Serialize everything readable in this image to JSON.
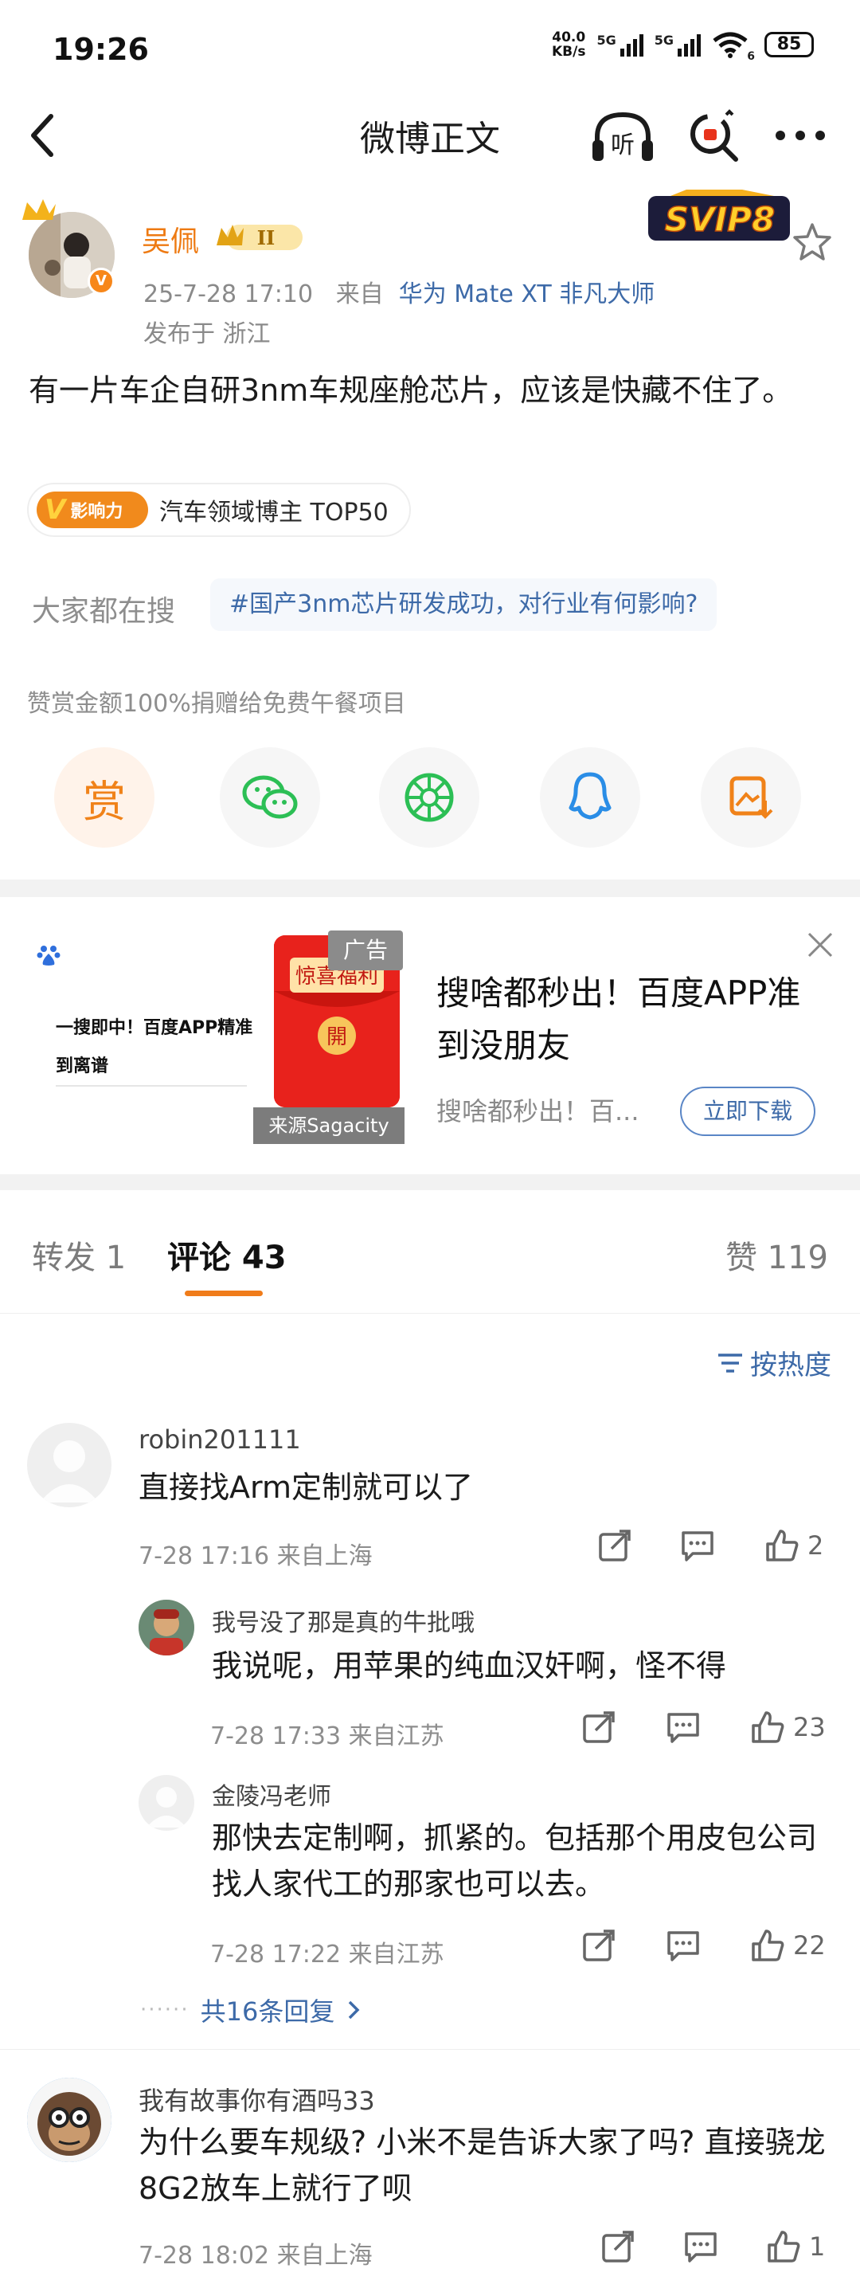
{
  "status_bar": {
    "time": "19:26",
    "net_speed_value": "40.0",
    "net_speed_unit": "KB/s",
    "signal1_label": "5G",
    "signal2_label": "5G",
    "wifi_badge": "6",
    "battery": "85"
  },
  "nav": {
    "title": "微博正文",
    "listen_label": "听"
  },
  "post": {
    "username": "吴佩",
    "rank_badge": "II",
    "svip_badge": "SVIP8",
    "date_time": "25-7-28 17:10",
    "source_prefix": "来自",
    "device": "华为 Mate XT 非凡大师",
    "location": "发布于 浙江",
    "text": "有一片车企自研3nm车规座舱芯片，应该是快藏不住了。",
    "influence_badge": "影响力",
    "influence_label": "汽车领域博主 TOP50",
    "hot_search_label": "大家都在搜",
    "hot_search_topic": "#国产3nm芯片研发成功，对行业有何影响?",
    "donate_note": "赞赏金额100%捐赠给免费午餐项目",
    "reward_label": "赏"
  },
  "ad": {
    "tag": "广告",
    "left_line1": "一搜即中！百度APP精准",
    "left_line2": "到离谱",
    "envelope_title": "惊喜福利",
    "envelope_button": "開",
    "source": "来源Sagacity",
    "title": "搜啥都秒出！百度APP准到没朋友",
    "subtitle": "搜啥都秒出！百...",
    "button": "立即下载"
  },
  "tabs": {
    "repost": "转发 1",
    "comments": "评论 43",
    "likes": "赞 119"
  },
  "sort_label": "按热度",
  "comments": [
    {
      "name": "robin201111",
      "text": "直接找Arm定制就可以了",
      "meta": "7-28 17:16  来自上海",
      "likes": "2",
      "replies": [
        {
          "name": "我号没了那是真的牛批哦",
          "text": "我说呢，用苹果的纯血汉奸啊，怪不得",
          "meta": "7-28 17:33  来自江苏",
          "likes": "23"
        },
        {
          "name": "金陵冯老师",
          "text": "那快去定制啊，抓紧的。包括那个用皮包公司找人家代工的那家也可以去。",
          "meta": "7-28 17:22  来自江苏",
          "likes": "22"
        }
      ],
      "more_replies": "共16条回复"
    },
    {
      "name": "我有故事你有酒吗33",
      "text": "为什么要车规级? 小米不是告诉大家了吗? 直接骁龙8G2放车上就行了呗",
      "meta": "7-28 18:02  来自上海",
      "likes": "1"
    }
  ],
  "colors": {
    "accent_orange": "#f07c1a",
    "link_blue": "#3d6aa8",
    "ad_red": "#e8221c"
  }
}
